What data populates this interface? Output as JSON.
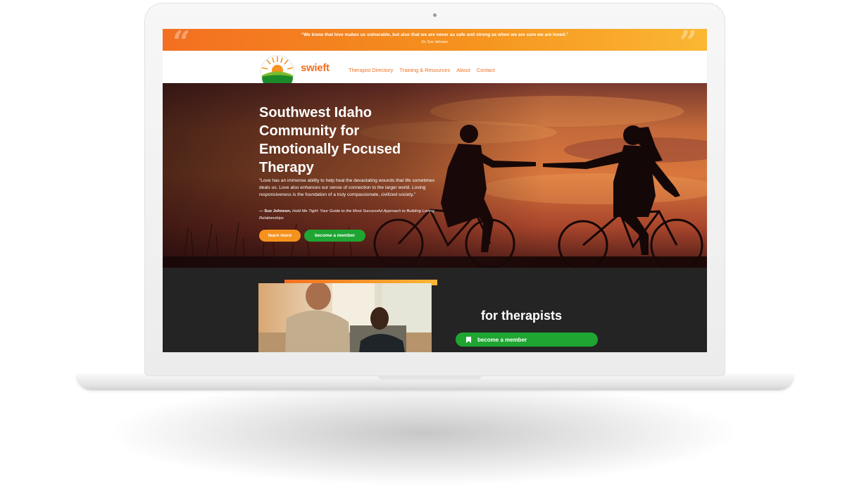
{
  "banner": {
    "quote": "“We know that love makes us vulnerable, but also that we are never as safe and strong as when we are sure we are loved.”",
    "author": "Dr. Sue Johnson"
  },
  "nav": {
    "brand": "swieft",
    "links": [
      "Therapist Directory",
      "Training & Resources",
      "About",
      "Contact"
    ]
  },
  "hero": {
    "title": "Southwest Idaho Community for Emotionally Focused Therapy",
    "quote": "“Love has an immense ability to help heal the devastating wounds that life sometimes deals us. Love also enhances our sense of connection to the larger world. Loving responsiveness is the foundation of a truly compassionate, civilized society.”",
    "cite_author": "— Sue Johnson,",
    "cite_book": "Hold Me Tight: Your Guide to the Most Successful Approach to Building Loving Relationships",
    "learn_more": "learn more",
    "become_member": "become a member"
  },
  "therapists": {
    "title": "for therapists",
    "button": "become a member",
    "button_icon": "bookmark-icon"
  },
  "colors": {
    "orange": "#f36f21",
    "amber": "#fbb733",
    "green": "#1ea532",
    "dark": "#242424"
  }
}
